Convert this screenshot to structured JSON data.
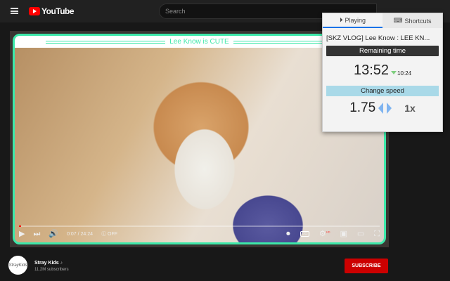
{
  "header": {
    "logo": "YouTube",
    "search_placeholder": "Search"
  },
  "video": {
    "banner": "Lee Know is CUTE",
    "time": "0:07 / 24:24",
    "progress_pct": 0.5,
    "lr_off": "OFF",
    "hd": "HD",
    "cc": "CC"
  },
  "popup": {
    "tab_playing": "Playing",
    "tab_shortcuts": "Shortcuts",
    "title": "[SKZ VLOG] Lee Know : LEE KN...",
    "remaining_label": "Remaining time",
    "remaining": "13:52",
    "original": "10:24",
    "change_label": "Change speed",
    "speed": "1.75",
    "reset": "1x"
  },
  "channel": {
    "name": "Stray Kids",
    "avatar": "StrayKids",
    "note": "♪",
    "subscribers": "11.2M subscribers",
    "subscribe": "SUBSCRIBE"
  }
}
